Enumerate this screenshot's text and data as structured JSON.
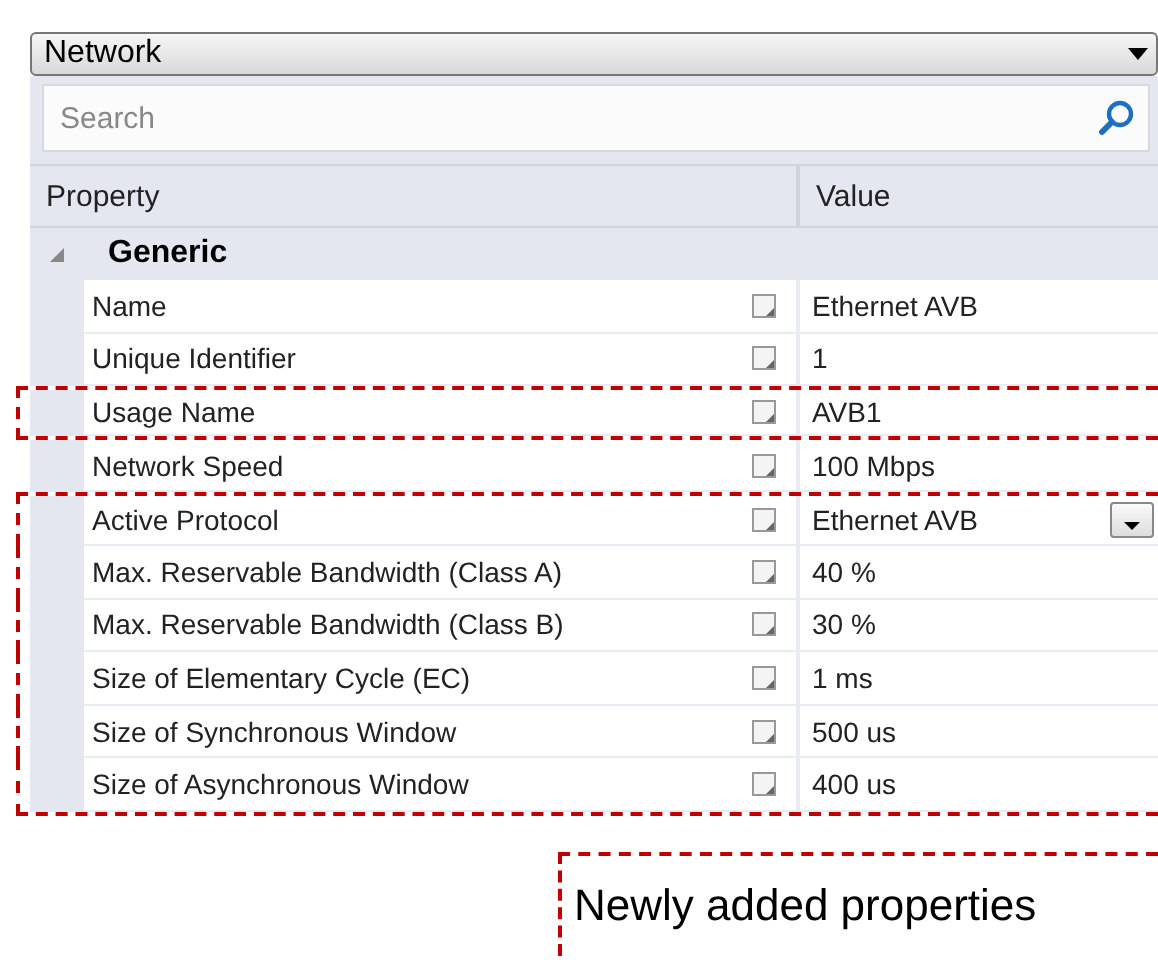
{
  "selector": {
    "value": "Network"
  },
  "search": {
    "placeholder": "Search"
  },
  "columns": [
    "Property",
    "Value"
  ],
  "category": {
    "label": "Generic",
    "expanded": true
  },
  "rows": [
    {
      "name": "Name",
      "value": "Ethernet AVB",
      "kind": "text",
      "highlighted": false
    },
    {
      "name": "Unique Identifier",
      "value": "1",
      "kind": "text",
      "highlighted": false
    },
    {
      "name": "Usage Name",
      "value": "AVB1",
      "kind": "text",
      "highlighted": true
    },
    {
      "name": "Network Speed",
      "value": "100 Mbps",
      "kind": "text",
      "highlighted": false
    },
    {
      "name": "Active Protocol",
      "value": "Ethernet AVB",
      "kind": "dropdown",
      "highlighted": true
    },
    {
      "name": "Max. Reservable Bandwidth (Class A)",
      "value": "40 %",
      "kind": "text",
      "highlighted": true
    },
    {
      "name": "Max. Reservable Bandwidth (Class B)",
      "value": "30 %",
      "kind": "text",
      "highlighted": true
    },
    {
      "name": "Size of Elementary Cycle (EC)",
      "value": "1 ms",
      "kind": "text",
      "highlighted": true
    },
    {
      "name": "Size of Synchronous Window",
      "value": "500 us",
      "kind": "text",
      "highlighted": true
    },
    {
      "name": "Size of Asynchronous Window",
      "value": "400 us",
      "kind": "text",
      "highlighted": true
    }
  ],
  "callout": {
    "text": "Newly added properties"
  }
}
